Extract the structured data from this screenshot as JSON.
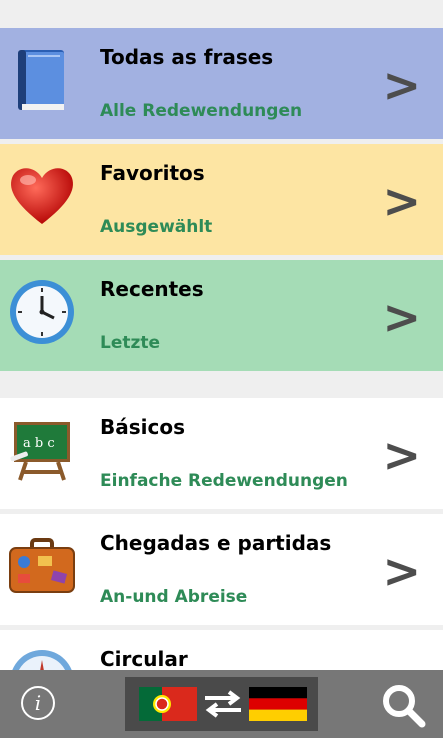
{
  "items": [
    {
      "title": "Todas as frases",
      "subtitle": "Alle Redewendungen",
      "icon": "book-icon",
      "bg": "#a2b1e1"
    },
    {
      "title": "Favoritos",
      "subtitle": "Ausgewählt",
      "icon": "heart-icon",
      "bg": "#fde5a3"
    },
    {
      "title": "Recentes",
      "subtitle": "Letzte",
      "icon": "clock-icon",
      "bg": "#a5dcb6"
    },
    {
      "title": "Básicos",
      "subtitle": "Einfache Redewendungen",
      "icon": "chalkboard-icon",
      "bg": "#ffffff"
    },
    {
      "title": "Chegadas e partidas",
      "subtitle": "An-und Abreise",
      "icon": "suitcase-icon",
      "bg": "#ffffff"
    },
    {
      "title": "Circular",
      "subtitle": "",
      "icon": "compass-icon",
      "bg": "#ffffff"
    }
  ],
  "chevron": ">",
  "bottom_bar": {
    "info_label": "i",
    "info_icon": "info-icon",
    "search_icon": "search-icon",
    "from_flag": "portugal-flag-icon",
    "to_flag": "germany-flag-icon",
    "swap_icon": "swap-arrows-icon"
  }
}
